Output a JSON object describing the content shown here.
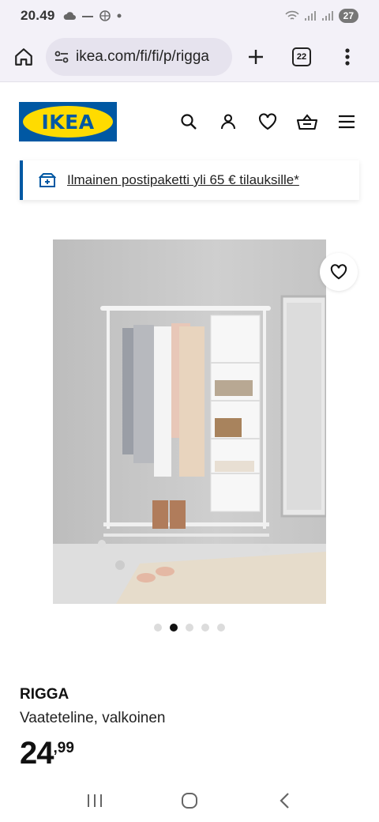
{
  "status_bar": {
    "time": "20.49",
    "battery": "27"
  },
  "browser": {
    "url": "ikea.com/fi/fi/p/rigga",
    "tab_count": "22"
  },
  "site": {
    "logo_text": "IKEA",
    "brand_blue": "#0058a3",
    "brand_yellow": "#ffdb00"
  },
  "header_icons": [
    "search-icon",
    "account-icon",
    "heart-icon",
    "basket-icon",
    "menu-icon"
  ],
  "banner": {
    "text": "Ilmainen postipaketti yli 65 € tilauksille*"
  },
  "carousel": {
    "slide_count": 5,
    "active_index": 1
  },
  "product": {
    "name": "RIGGA",
    "description": "Vaateteline, valkoinen",
    "price_integer": "24",
    "price_decimal": ",99"
  }
}
